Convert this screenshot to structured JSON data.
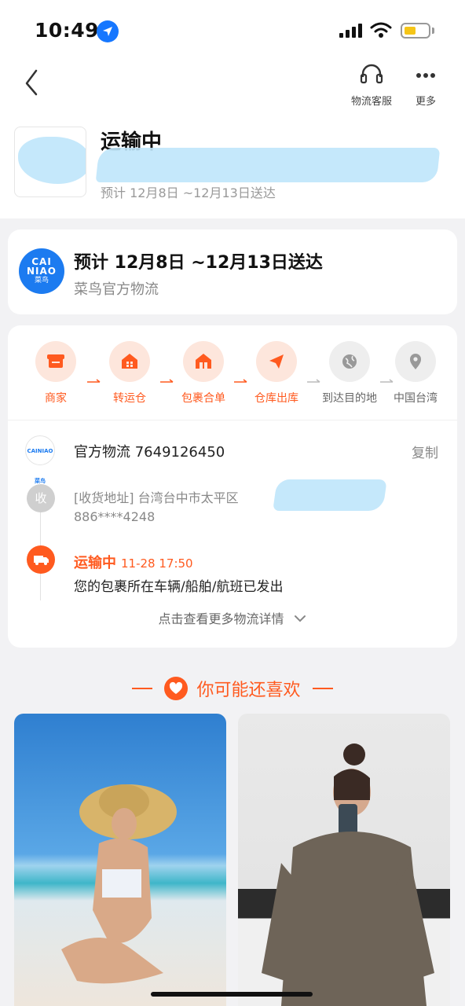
{
  "status_bar": {
    "time": "10:49"
  },
  "nav": {
    "customer_service_label": "物流客服",
    "more_label": "更多"
  },
  "header": {
    "status": "运输中",
    "eta": "预计 12月8日 ~12月13日送达"
  },
  "eta_card": {
    "title": "预计 12月8日 ~12月13日送达",
    "carrier": "菜鸟官方物流",
    "logo_line1": "CAI",
    "logo_line2": "NIAO",
    "logo_line3": "菜鸟"
  },
  "steps": [
    {
      "label": "商家",
      "state": "active",
      "icon": "store-icon"
    },
    {
      "label": "转运仓",
      "state": "active",
      "icon": "warehouse-icon"
    },
    {
      "label": "包裹合单",
      "state": "active",
      "icon": "package-merge-icon"
    },
    {
      "label": "仓库出库",
      "state": "active",
      "icon": "send-icon"
    },
    {
      "label": "到达目的地",
      "state": "inactive",
      "icon": "globe-icon"
    },
    {
      "label": "中国台湾",
      "state": "inactive",
      "icon": "location-icon"
    }
  ],
  "tracking": {
    "carrier_line": "官方物流 7649126450",
    "copy_label": "复制",
    "mini_logo": "CAINIAO 菜鸟",
    "address_badge": "收",
    "address": "[收货地址] 台湾台中市太平区",
    "phone": "886****4248",
    "status": "运输中",
    "status_time": "11-28 17:50",
    "status_detail": "您的包裹所在车辆/船舶/航班已发出",
    "more_details": "点击查看更多物流详情"
  },
  "recommend": {
    "title": "你可能还喜欢"
  },
  "colors": {
    "accent": "#ff5a1f",
    "cainiao_blue": "#1c7bf0",
    "redaction": "#bfe6fb"
  }
}
